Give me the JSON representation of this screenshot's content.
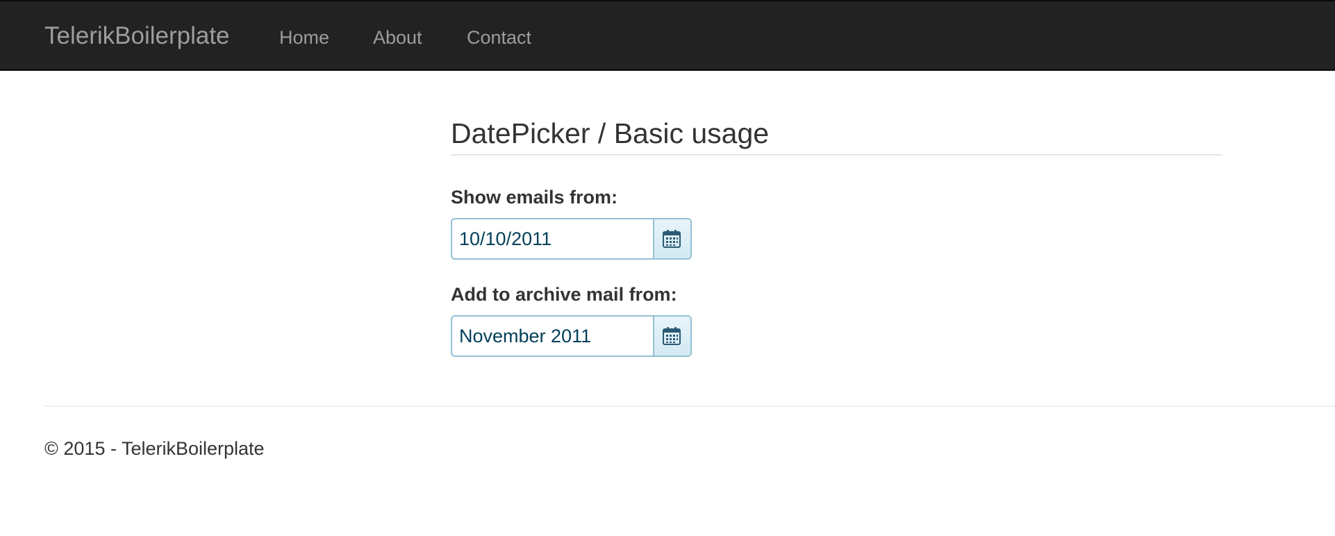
{
  "navbar": {
    "brand": "TelerikBoilerplate",
    "links": [
      {
        "label": "Home"
      },
      {
        "label": "About"
      },
      {
        "label": "Contact"
      }
    ],
    "background": "#222222",
    "link_color": "#9d9d9d"
  },
  "main": {
    "title": "DatePicker / Basic usage",
    "fields": [
      {
        "label": "Show emails from:",
        "value": "10/10/2011",
        "icon": "calendar-icon"
      },
      {
        "label": "Add to archive mail from:",
        "value": "November 2011",
        "icon": "calendar-icon"
      }
    ],
    "accent_border": "#94c0d2",
    "input_text_color": "#003f59"
  },
  "footer": {
    "text": "© 2015 - TelerikBoilerplate"
  }
}
